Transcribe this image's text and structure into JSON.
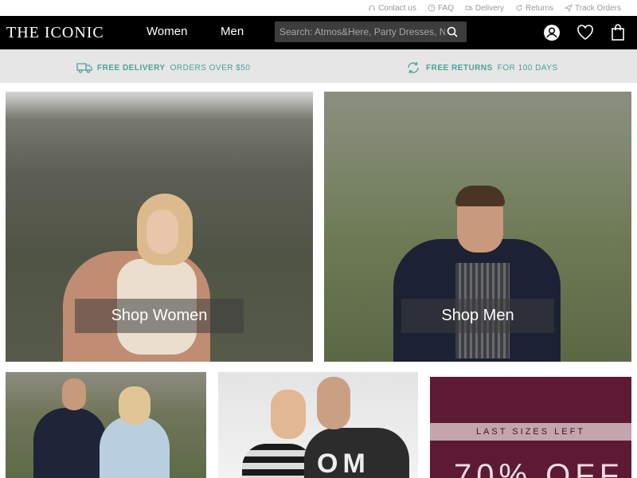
{
  "utility_nav": [
    {
      "label": "Contact us",
      "icon": "headset-icon"
    },
    {
      "label": "FAQ",
      "icon": "question-icon"
    },
    {
      "label": "Delivery",
      "icon": "truck-icon"
    },
    {
      "label": "Returns",
      "icon": "returns-icon"
    },
    {
      "label": "Track Orders",
      "icon": "send-icon"
    }
  ],
  "header": {
    "logo": "THE ICONIC",
    "nav_women": "Women",
    "nav_men": "Men",
    "search_placeholder": "Search: Atmos&Here, Party Dresses, Nike",
    "icons": [
      "account-icon",
      "heart-icon",
      "bag-icon"
    ]
  },
  "promo": {
    "delivery_bold": "FREE DELIVERY",
    "delivery_rest": "ORDERS OVER $50",
    "returns_bold": "FREE RETURNS",
    "returns_rest": "FOR 100 DAYS"
  },
  "hero": {
    "women_button": "Shop Women",
    "men_button": "Shop Men"
  },
  "tiles": {
    "tile2_text": "OM",
    "tile3_band": "LAST SIZES LEFT",
    "tile3_sale": "70% OFF"
  },
  "colors": {
    "header_bg": "#000000",
    "promo_bg": "#e6e6e6",
    "promo_accent": "#4aa196",
    "tile3_bg": "#5d1a33"
  }
}
